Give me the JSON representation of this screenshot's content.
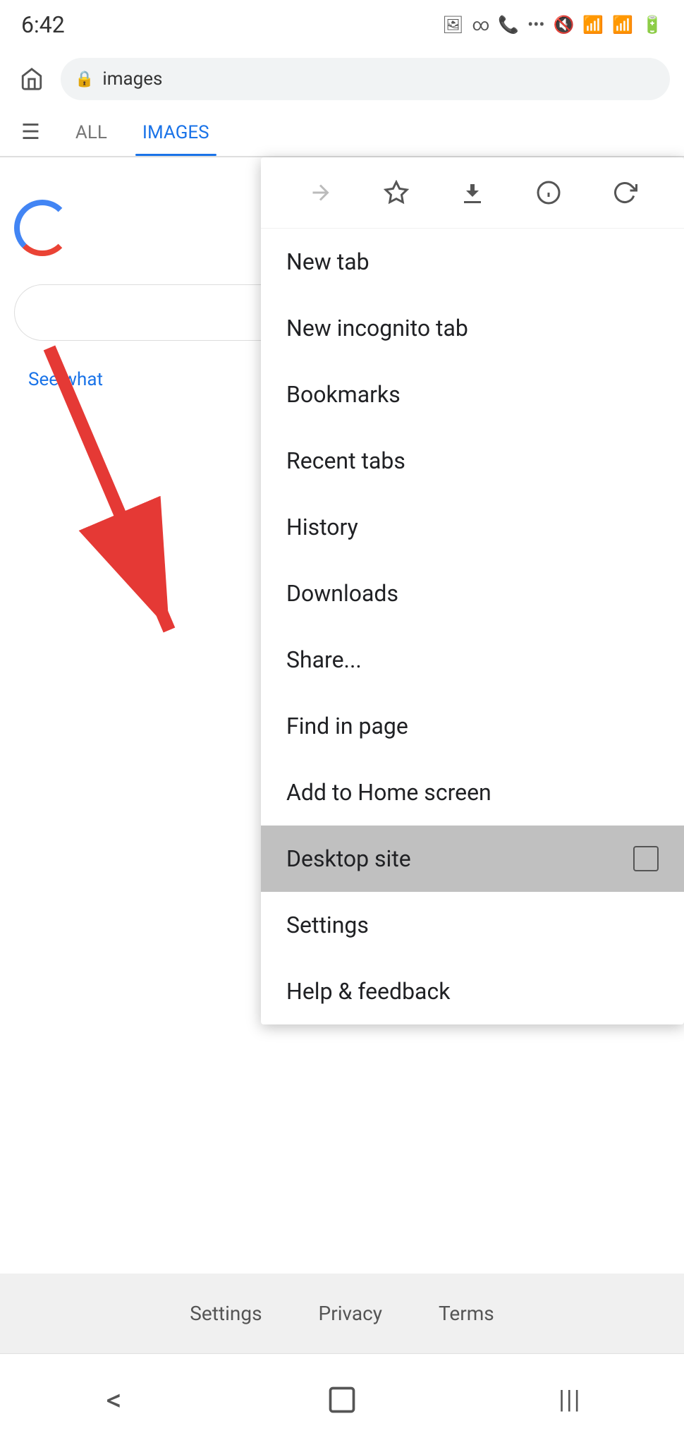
{
  "statusBar": {
    "time": "6:42",
    "icons": [
      "image",
      "link",
      "call",
      "more"
    ]
  },
  "addressBar": {
    "url": "images",
    "lockIcon": "🔒"
  },
  "tabs": [
    {
      "label": "ALL",
      "active": false
    },
    {
      "label": "IMAGES",
      "active": true
    }
  ],
  "toolbar": {
    "forwardIcon": "→",
    "bookmarkIcon": "☆",
    "downloadIcon": "⬇",
    "infoIcon": "ⓘ",
    "refreshIcon": "↻"
  },
  "menu": {
    "items": [
      {
        "label": "New tab",
        "hasCheckbox": false,
        "highlighted": false
      },
      {
        "label": "New incognito tab",
        "hasCheckbox": false,
        "highlighted": false
      },
      {
        "label": "Bookmarks",
        "hasCheckbox": false,
        "highlighted": false
      },
      {
        "label": "Recent tabs",
        "hasCheckbox": false,
        "highlighted": false
      },
      {
        "label": "History",
        "hasCheckbox": false,
        "highlighted": false
      },
      {
        "label": "Downloads",
        "hasCheckbox": false,
        "highlighted": false
      },
      {
        "label": "Share...",
        "hasCheckbox": false,
        "highlighted": false
      },
      {
        "label": "Find in page",
        "hasCheckbox": false,
        "highlighted": false
      },
      {
        "label": "Add to Home screen",
        "hasCheckbox": false,
        "highlighted": false
      },
      {
        "label": "Desktop site",
        "hasCheckbox": true,
        "highlighted": true
      },
      {
        "label": "Settings",
        "hasCheckbox": false,
        "highlighted": false
      },
      {
        "label": "Help & feedback",
        "hasCheckbox": false,
        "highlighted": false
      }
    ]
  },
  "footer": {
    "links": [
      "Settings",
      "Privacy",
      "Terms"
    ]
  },
  "navBar": {
    "back": "<",
    "home": "□",
    "recents": "|||"
  },
  "seeWhat": "See what"
}
